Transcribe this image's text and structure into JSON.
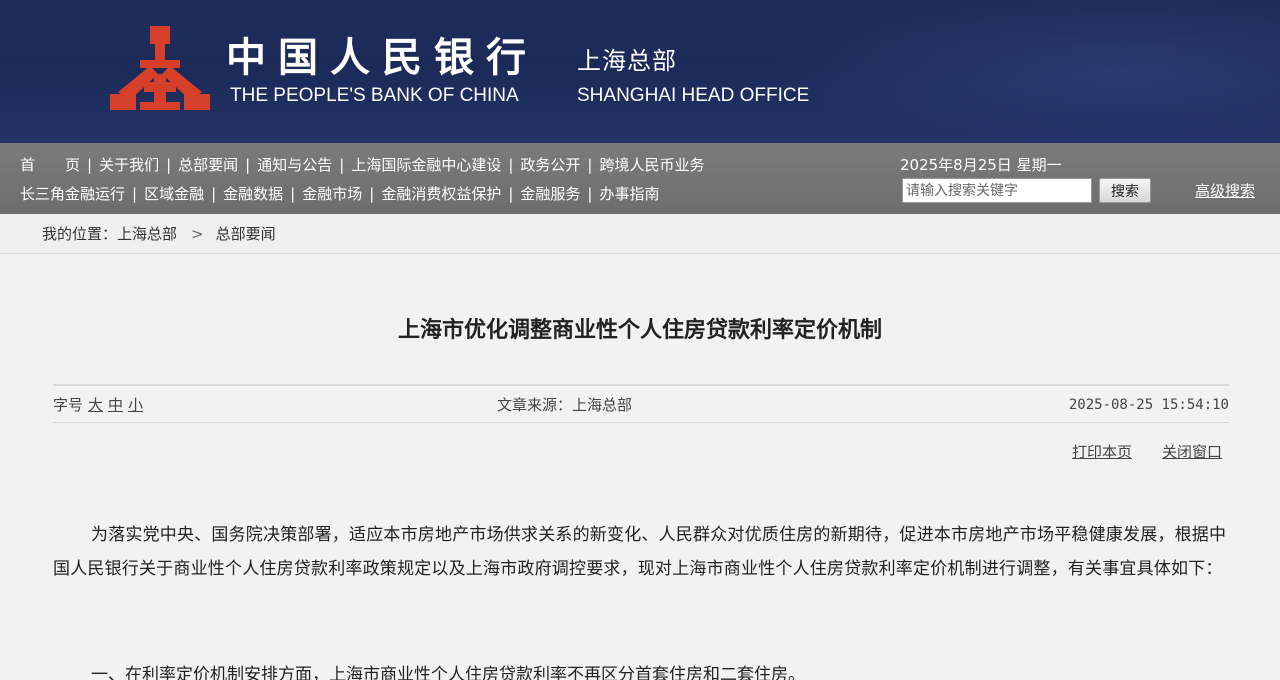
{
  "header": {
    "cn_name": "中国人民银行",
    "cn_sub": "上海总部",
    "en_name": "THE PEOPLE'S BANK OF CHINA",
    "en_sub": "SHANGHAI HEAD OFFICE",
    "logo_color": "#d6402a"
  },
  "nav": {
    "row1": [
      "首　　页",
      "关于我们",
      "总部要闻",
      "通知与公告",
      "上海国际金融中心建设",
      "政务公开",
      "跨境人民币业务"
    ],
    "row2": [
      "长三角金融运行",
      "区域金融",
      "金融数据",
      "金融市场",
      "金融消费权益保护",
      "金融服务",
      "办事指南"
    ],
    "date": "2025年8月25日 星期一",
    "search_placeholder": "请输入搜索关键字",
    "search_button": "搜索",
    "advanced_search": "高级搜索"
  },
  "breadcrumb": {
    "prefix": "我的位置：",
    "items": [
      "上海总部",
      "总部要闻"
    ],
    "arrow": ">"
  },
  "article": {
    "title": "上海市优化调整商业性个人住房贷款利率定价机制",
    "font_label": "字号",
    "font_sizes": [
      "大",
      "中",
      "小"
    ],
    "source": "文章来源：上海总部",
    "time": "2025-08-25 15:54:10",
    "print": "打印本页",
    "close": "关闭窗口",
    "paragraphs": [
      "为落实党中央、国务院决策部署，适应本市房地产市场供求关系的新变化、人民群众对优质住房的新期待，促进本市房地产市场平稳健康发展，根据中国人民银行关于商业性个人住房贷款利率政策规定以及上海市政府调控要求，现对上海市商业性个人住房贷款利率定价机制进行调整，有关事宜具体如下：",
      "一、在利率定价机制安排方面，上海市商业性个人住房贷款利率不再区分首套住房和二套住房。"
    ]
  }
}
